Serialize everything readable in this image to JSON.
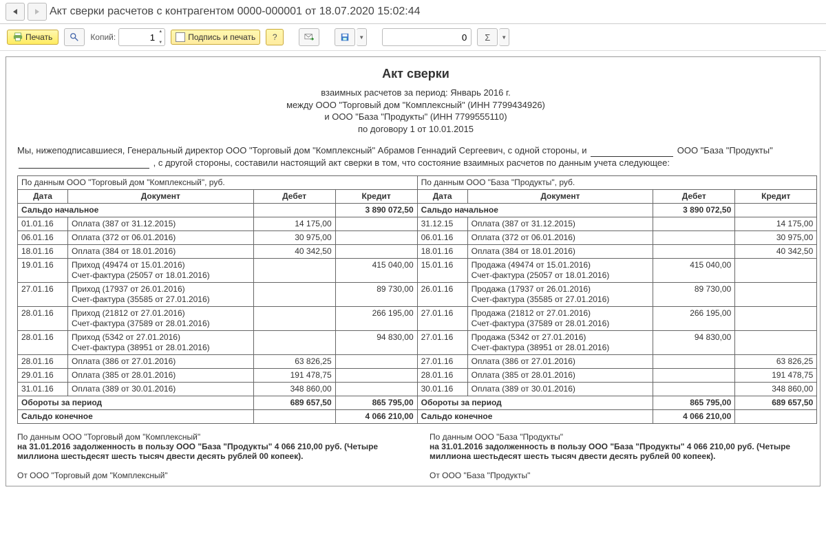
{
  "window": {
    "title": "Акт сверки расчетов с контрагентом 0000-000001 от 18.07.2020 15:02:44"
  },
  "toolbar": {
    "print": "Печать",
    "copies_label": "Копий:",
    "copies_value": "1",
    "sign_and_print": "Подпись и печать",
    "number_field": "0",
    "help": "?"
  },
  "doc": {
    "title": "Акт сверки",
    "sub1": "взаимных расчетов за период: Январь 2016 г.",
    "sub2": "между ООО \"Торговый дом \"Комплексный\" (ИНН 7799434926)",
    "sub3": "и ООО \"База \"Продукты\" (ИНН 7799555110)",
    "sub4": "по договору 1 от 10.01.2015",
    "preamble_1": "Мы, нижеподписавшиеся, Генеральный директор ООО \"Торговый дом \"Комплексный\" Абрамов Геннадий Сергеевич, с одной стороны, и ",
    "preamble_org": "ООО \"База \"Продукты\" ",
    "preamble_2": ", с другой стороны, составили настоящий акт сверки в том, что состояние взаимных расчетов по данным учета следующее:"
  },
  "table": {
    "left_header": "По данным ООО \"Торговый дом \"Комплексный\", руб.",
    "right_header": "По данным ООО \"База \"Продукты\", руб.",
    "col_date": "Дата",
    "col_doc": "Документ",
    "col_debit": "Дебет",
    "col_credit": "Кредит",
    "row_begin": "Сальдо начальное",
    "row_turn": "Обороты за период",
    "row_end": "Сальдо конечное",
    "left": {
      "begin_debit": "",
      "begin_credit": "3 890 072,50",
      "rows": [
        {
          "date": "01.01.16",
          "doc": "Оплата (387 от 31.12.2015)",
          "debit": "14 175,00",
          "credit": ""
        },
        {
          "date": "06.01.16",
          "doc": "Оплата (372 от 06.01.2016)",
          "debit": "30 975,00",
          "credit": ""
        },
        {
          "date": "18.01.16",
          "doc": "Оплата (384 от 18.01.2016)",
          "debit": "40 342,50",
          "credit": ""
        },
        {
          "date": "19.01.16",
          "doc": "Приход (49474 от 15.01.2016)\nСчет-фактура (25057 от 18.01.2016)",
          "debit": "",
          "credit": "415 040,00"
        },
        {
          "date": "27.01.16",
          "doc": "Приход (17937 от 26.01.2016)\nСчет-фактура (35585 от 27.01.2016)",
          "debit": "",
          "credit": "89 730,00"
        },
        {
          "date": "28.01.16",
          "doc": "Приход (21812 от 27.01.2016)\nСчет-фактура (37589 от 28.01.2016)",
          "debit": "",
          "credit": "266 195,00"
        },
        {
          "date": "28.01.16",
          "doc": "Приход (5342 от 27.01.2016)\nСчет-фактура (38951 от 28.01.2016)",
          "debit": "",
          "credit": "94 830,00"
        },
        {
          "date": "28.01.16",
          "doc": "Оплата (386 от 27.01.2016)",
          "debit": "63 826,25",
          "credit": ""
        },
        {
          "date": "29.01.16",
          "doc": "Оплата (385 от 28.01.2016)",
          "debit": "191 478,75",
          "credit": ""
        },
        {
          "date": "31.01.16",
          "doc": "Оплата (389 от 30.01.2016)",
          "debit": "348 860,00",
          "credit": ""
        }
      ],
      "turn_debit": "689 657,50",
      "turn_credit": "865 795,00",
      "end_debit": "",
      "end_credit": "4 066 210,00"
    },
    "right": {
      "begin_debit": "3 890 072,50",
      "begin_credit": "",
      "rows": [
        {
          "date": "31.12.15",
          "doc": "Оплата (387 от 31.12.2015)",
          "debit": "",
          "credit": "14 175,00"
        },
        {
          "date": "06.01.16",
          "doc": "Оплата (372 от 06.01.2016)",
          "debit": "",
          "credit": "30 975,00"
        },
        {
          "date": "18.01.16",
          "doc": "Оплата (384 от 18.01.2016)",
          "debit": "",
          "credit": "40 342,50"
        },
        {
          "date": "15.01.16",
          "doc": "Продажа (49474 от 15.01.2016)\nСчет-фактура (25057 от 18.01.2016)",
          "debit": "415 040,00",
          "credit": ""
        },
        {
          "date": "26.01.16",
          "doc": "Продажа (17937 от 26.01.2016)\nСчет-фактура (35585 от 27.01.2016)",
          "debit": "89 730,00",
          "credit": ""
        },
        {
          "date": "27.01.16",
          "doc": "Продажа (21812 от 27.01.2016)\nСчет-фактура (37589 от 28.01.2016)",
          "debit": "266 195,00",
          "credit": ""
        },
        {
          "date": "27.01.16",
          "doc": "Продажа (5342 от 27.01.2016)\nСчет-фактура (38951 от 28.01.2016)",
          "debit": "94 830,00",
          "credit": ""
        },
        {
          "date": "27.01.16",
          "doc": "Оплата (386 от 27.01.2016)",
          "debit": "",
          "credit": "63 826,25"
        },
        {
          "date": "28.01.16",
          "doc": "Оплата (385 от 28.01.2016)",
          "debit": "",
          "credit": "191 478,75"
        },
        {
          "date": "30.01.16",
          "doc": "Оплата (389 от 30.01.2016)",
          "debit": "",
          "credit": "348 860,00"
        }
      ],
      "turn_debit": "865 795,00",
      "turn_credit": "689 657,50",
      "end_debit": "4 066 210,00",
      "end_credit": ""
    }
  },
  "footer": {
    "left_source": "По данным ООО \"Торговый дом \"Комплексный\"",
    "right_source": "По данным ООО \"База \"Продукты\"",
    "left_text": "на 31.01.2016 задолженность в пользу ООО \"База \"Продукты\" 4 066 210,00 руб. (Четыре миллиона шестьдесят шесть тысяч двести десять рублей 00 копеек).",
    "right_text": "на 31.01.2016 задолженность в пользу ООО \"База \"Продукты\" 4 066 210,00 руб. (Четыре миллиона шестьдесят шесть тысяч двести десять рублей 00 копеек).",
    "from_left": "От ООО \"Торговый дом \"Комплексный\"",
    "from_right": "От ООО \"База \"Продукты\""
  }
}
